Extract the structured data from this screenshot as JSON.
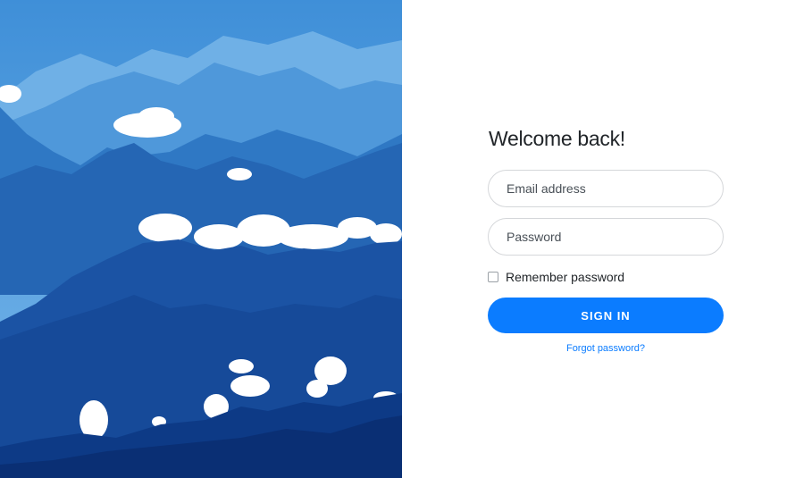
{
  "hero": {
    "image_name": "mountain-landscape-photo",
    "colors": {
      "sky": "#4b9be0",
      "far_ridge": "#5a9fd8",
      "mid_ridge": "#2f73c0",
      "near_ridge": "#1c56a8",
      "front_ridge": "#0d3a86",
      "cloud": "#ffffff"
    }
  },
  "login": {
    "title": "Welcome back!",
    "email": {
      "placeholder": "Email address",
      "value": ""
    },
    "password": {
      "placeholder": "Password",
      "value": ""
    },
    "remember_label": "Remember password",
    "remember_checked": false,
    "signin_label": "SIGN IN",
    "forgot_label": "Forgot password?"
  },
  "colors": {
    "accent": "#0b7cff",
    "text": "#212529",
    "border": "#d5d7da"
  }
}
